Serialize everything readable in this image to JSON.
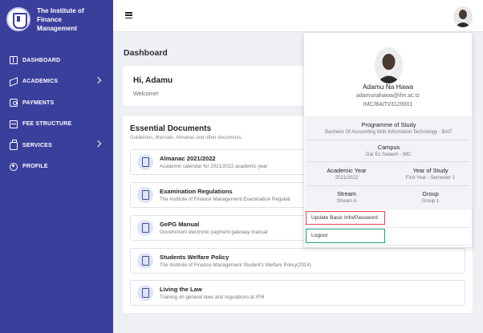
{
  "brand": {
    "name_line1": "The Institute of Finance",
    "name_line2": "Management"
  },
  "sidebar": {
    "items": [
      {
        "label": "DASHBOARD",
        "icon": "dashboard-icon"
      },
      {
        "label": "ACADEMICS",
        "icon": "graduation-cap-icon",
        "has_children": true
      },
      {
        "label": "PAYMENTS",
        "icon": "payments-icon"
      },
      {
        "label": "FEE STRUCTURE",
        "icon": "fee-structure-icon"
      },
      {
        "label": "SERVICES",
        "icon": "briefcase-icon",
        "has_children": true
      },
      {
        "label": "PROFILE",
        "icon": "profile-icon"
      }
    ]
  },
  "main": {
    "title": "Dashboard",
    "welcome": {
      "greeting": "Hi, Adamu",
      "message": "Welcome!"
    },
    "documents": {
      "heading": "Essential Documents",
      "subheading": "Guidelines, Manuals, Almanac and other documents",
      "items": [
        {
          "name": "Almanac 2021/2022",
          "desc": "Academic calendar for 2021/2022 academic year"
        },
        {
          "name": "Examination Regulations",
          "desc": "The Institute of Finance Management Examination Regulati"
        },
        {
          "name": "GePG Manual",
          "desc": "Government electronic payment gateway manual"
        },
        {
          "name": "Students Welfare Policy",
          "desc": "The Institute of Finance Management Student's Welfare Policy(2014)"
        },
        {
          "name": "Living the Law",
          "desc": "Training on general laws and regulations at IFM"
        }
      ]
    }
  },
  "profile": {
    "name": "Adamu Na Hawa",
    "email": "adamunahawa@ifm.ac.tz",
    "reg_no": "IMC/BAITI/3129001",
    "programme_label": "Programme of Study",
    "programme_value": "Bachelor Of Accounting With Information Technology - BAIT",
    "campus_label": "Campus",
    "campus_value": "Dar Es Salaam - IMC",
    "academic_year_label": "Academic Year",
    "academic_year_value": "2021/2022",
    "year_of_study_label": "Year of Study",
    "year_of_study_value": "First Year - Semester 1",
    "stream_label": "Stream",
    "stream_value": "Stream A",
    "group_label": "Group",
    "group_value": "Group 1",
    "update_label": "Update Basic Info/Password",
    "logout_label": "Logout"
  },
  "colors": {
    "sidebar": "#3b3f9c",
    "highlight_red": "#e0474c",
    "highlight_green": "#1f9e76"
  }
}
